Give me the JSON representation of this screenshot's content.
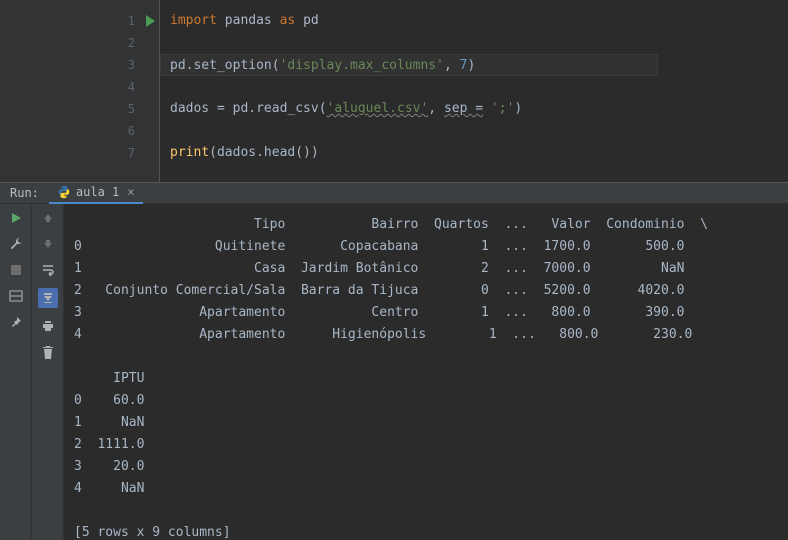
{
  "editor": {
    "lines": [
      {
        "n": "1",
        "run": true,
        "tokens": [
          [
            "kw",
            "import"
          ],
          [
            "",
            " "
          ],
          [
            "fn",
            "pandas"
          ],
          [
            "",
            " "
          ],
          [
            "kw",
            "as"
          ],
          [
            "",
            " "
          ],
          [
            "fn",
            "pd"
          ]
        ]
      },
      {
        "n": "2",
        "run": false,
        "tokens": []
      },
      {
        "n": "3",
        "run": false,
        "highlight": true,
        "tokens": [
          [
            "fn",
            "pd.set_option("
          ],
          [
            "str",
            "'display.max_columns'"
          ],
          [
            "fn",
            ", "
          ],
          [
            "num",
            "7"
          ],
          [
            "fn",
            ")"
          ]
        ]
      },
      {
        "n": "4",
        "run": false,
        "tokens": []
      },
      {
        "n": "5",
        "run": false,
        "tokens": [
          [
            "fn",
            "dados = pd.read_csv("
          ],
          [
            "str under",
            "'aluguel.csv'"
          ],
          [
            "fn",
            ", "
          ],
          [
            "under",
            "sep ="
          ],
          [
            "fn",
            " "
          ],
          [
            "str",
            "';'"
          ],
          [
            "fn",
            ")"
          ]
        ]
      },
      {
        "n": "6",
        "run": false,
        "tokens": []
      },
      {
        "n": "7",
        "run": false,
        "tokens": [
          [
            "call",
            "print"
          ],
          [
            "fn",
            "(dados.head())"
          ]
        ]
      }
    ]
  },
  "run": {
    "label": "Run:",
    "tab_name": "aula 1",
    "output": "                       Tipo           Bairro  Quartos  ...   Valor  Condominio  \\\n0                 Quitinete       Copacabana        1  ...  1700.0       500.0   \n1                      Casa  Jardim Botânico        2  ...  7000.0         NaN   \n2   Conjunto Comercial/Sala  Barra da Tijuca        0  ...  5200.0      4020.0   \n3               Apartamento           Centro        1  ...   800.0       390.0   \n4               Apartamento      Higienópolis        1  ...   800.0       230.0   \n\n     IPTU  \n0    60.0  \n1     NaN  \n2  1111.0  \n3    20.0  \n4     NaN  \n\n[5 rows x 9 columns]"
  }
}
